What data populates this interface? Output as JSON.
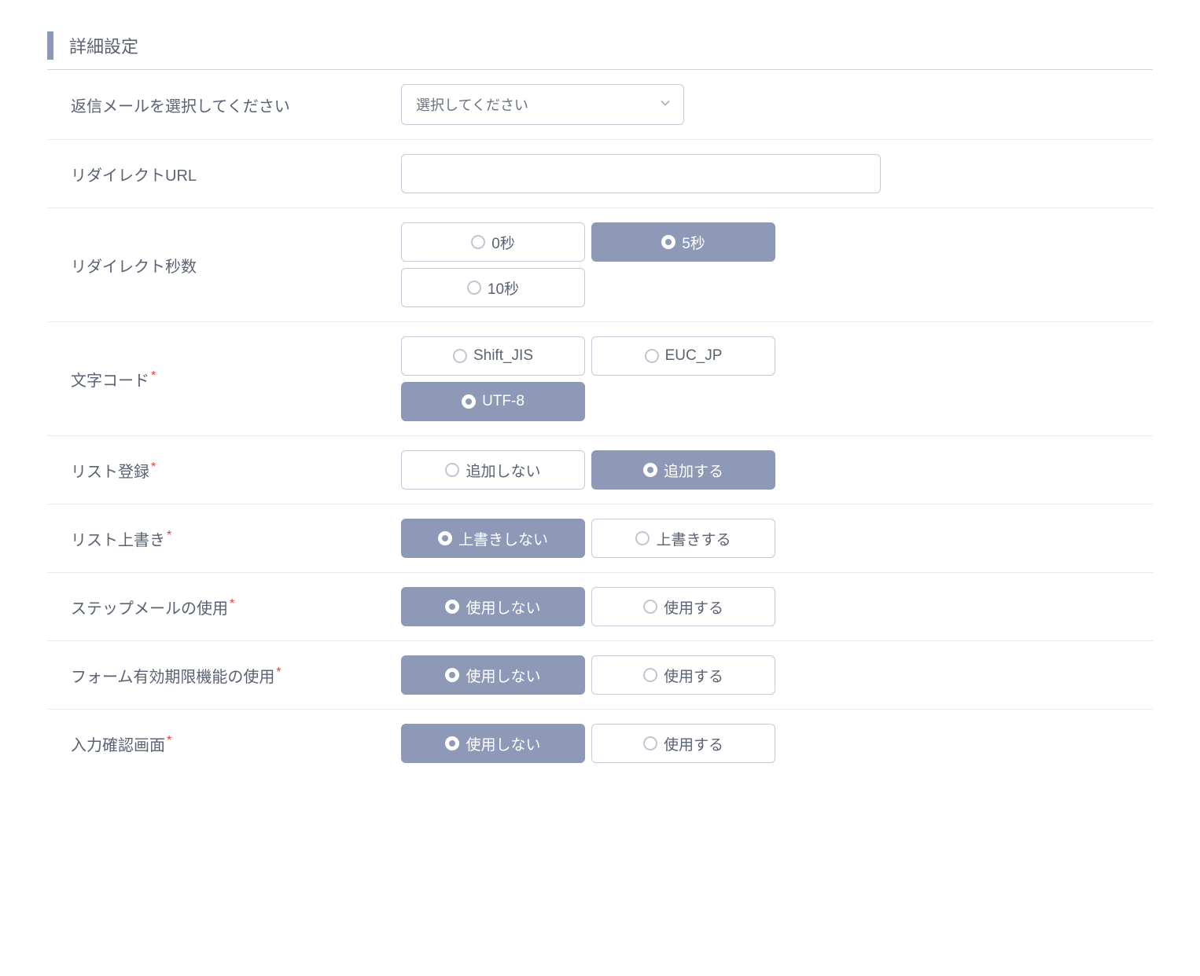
{
  "section": {
    "title": "詳細設定"
  },
  "rows": {
    "reply_mail": {
      "label": "返信メールを選択してください",
      "required": false,
      "placeholder": "選択してください"
    },
    "redirect_url": {
      "label": "リダイレクトURL",
      "required": false,
      "value": ""
    },
    "redirect_seconds": {
      "label": "リダイレクト秒数",
      "required": false,
      "options": [
        {
          "label": "0秒",
          "selected": false
        },
        {
          "label": "5秒",
          "selected": true
        },
        {
          "label": "10秒",
          "selected": false
        }
      ]
    },
    "charset": {
      "label": "文字コード",
      "required": true,
      "options": [
        {
          "label": "Shift_JIS",
          "selected": false
        },
        {
          "label": "EUC_JP",
          "selected": false
        },
        {
          "label": "UTF-8",
          "selected": true
        }
      ]
    },
    "list_register": {
      "label": "リスト登録",
      "required": true,
      "options": [
        {
          "label": "追加しない",
          "selected": false
        },
        {
          "label": "追加する",
          "selected": true
        }
      ]
    },
    "list_overwrite": {
      "label": "リスト上書き",
      "required": true,
      "options": [
        {
          "label": "上書きしない",
          "selected": true
        },
        {
          "label": "上書きする",
          "selected": false
        }
      ]
    },
    "step_mail": {
      "label": "ステップメールの使用",
      "required": true,
      "options": [
        {
          "label": "使用しない",
          "selected": true
        },
        {
          "label": "使用する",
          "selected": false
        }
      ]
    },
    "form_expiry": {
      "label": "フォーム有効期限機能の使用",
      "required": true,
      "options": [
        {
          "label": "使用しない",
          "selected": true
        },
        {
          "label": "使用する",
          "selected": false
        }
      ]
    },
    "input_confirm": {
      "label": "入力確認画面",
      "required": true,
      "options": [
        {
          "label": "使用しない",
          "selected": true
        },
        {
          "label": "使用する",
          "selected": false
        }
      ]
    }
  }
}
